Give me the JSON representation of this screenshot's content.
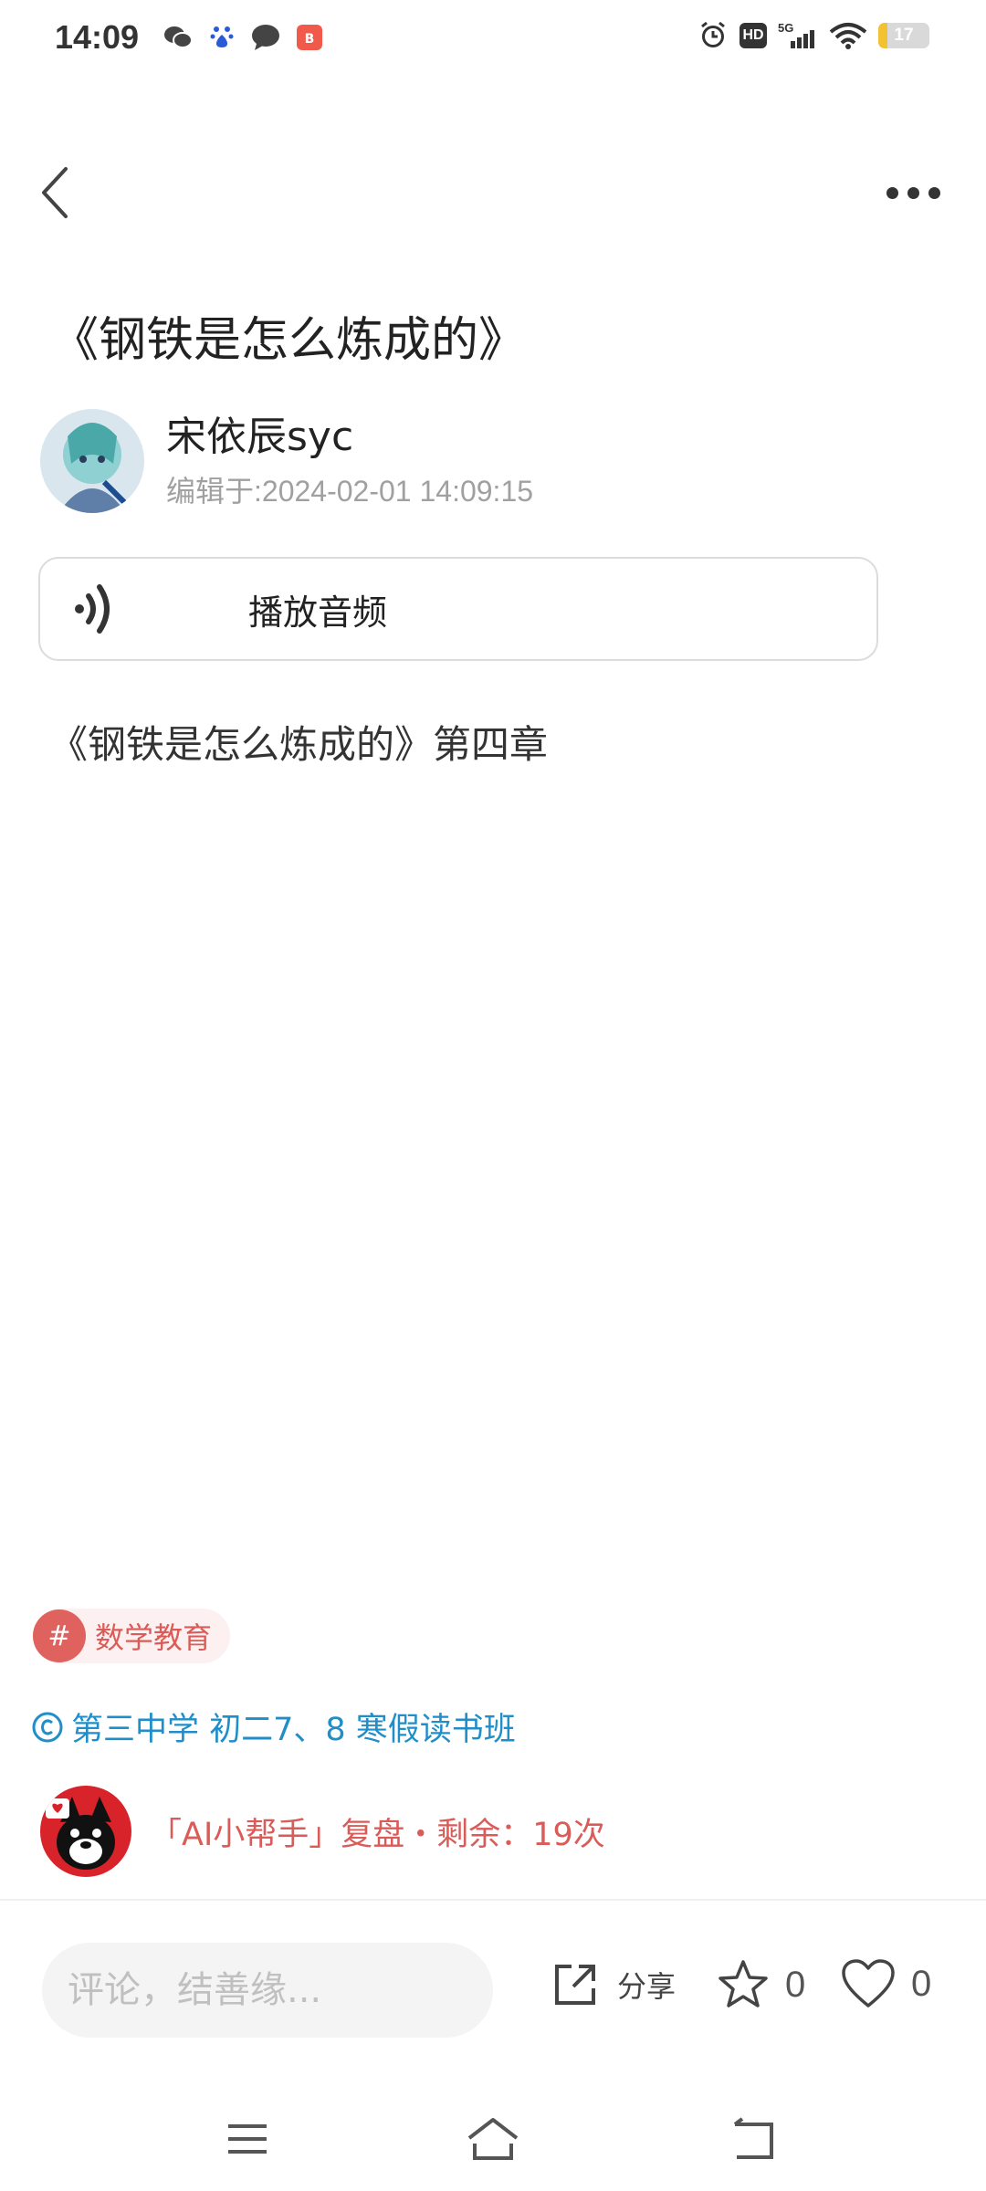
{
  "status_bar": {
    "time": "14:09",
    "battery": "17",
    "network": "5G",
    "hd": "HD",
    "left_icons": [
      "wechat-icon",
      "baidu-icon",
      "message-icon",
      "app-icon"
    ],
    "right_icons": [
      "alarm-icon",
      "hd-icon",
      "signal-5g-icon",
      "wifi-icon",
      "battery-icon"
    ]
  },
  "header": {
    "back_icon": "chevron-left-icon",
    "more_icon": "more-dots-icon"
  },
  "post": {
    "title": "《钢铁是怎么炼成的》",
    "author_name": "宋依辰syc",
    "edit_time": "编辑于:2024-02-01 14:09:15",
    "audio_label": "播放音频",
    "content": "《钢铁是怎么炼成的》第四章"
  },
  "tag": {
    "hash": "#",
    "label": "数学教育"
  },
  "class_link": {
    "label": "第三中学 初二7、8 寒假读书班"
  },
  "ai_helper": {
    "label": "「AI小帮手」复盘・剩余：19次"
  },
  "bottom_bar": {
    "comment_placeholder": "评论，结善缘...",
    "share_label": "分享",
    "favorite_count": "0",
    "like_count": "0"
  },
  "colors": {
    "accent_red": "#d95c58",
    "link_blue": "#1f8ec9",
    "battery_yellow": "#f2c230"
  }
}
